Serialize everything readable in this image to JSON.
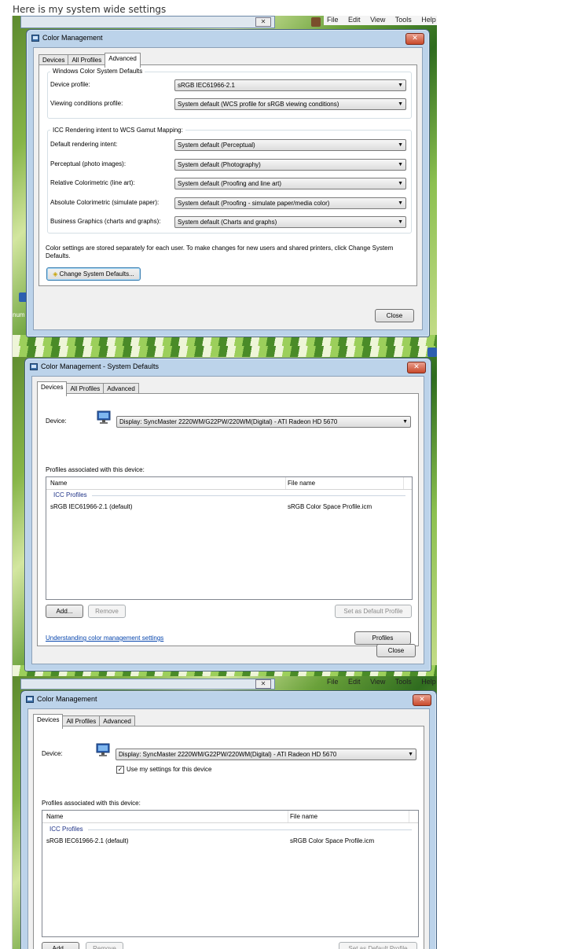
{
  "post": {
    "caption": "Here is my system wide settings"
  },
  "background": {
    "menu": [
      "File",
      "Edit",
      "View",
      "Tools",
      "Help"
    ],
    "menu_b": [
      "File",
      "Edit",
      "View",
      "Tools",
      "Help"
    ],
    "side_label": "num"
  },
  "shot1": {
    "title": "Color Management",
    "tabs": [
      "Devices",
      "All Profiles",
      "Advanced"
    ],
    "wcs_group": "Windows Color System Defaults",
    "device_profile_label": "Device profile:",
    "device_profile_value": "sRGB IEC61966-2.1",
    "viewing_label": "Viewing conditions profile:",
    "viewing_value": "System default (WCS profile for sRGB viewing conditions)",
    "icc_group": "ICC Rendering intent to WCS Gamut Mapping:",
    "rows": [
      {
        "label": "Default rendering intent:",
        "value": "System default (Perceptual)"
      },
      {
        "label": "Perceptual (photo images):",
        "value": "System default (Photography)"
      },
      {
        "label": "Relative Colorimetric (line art):",
        "value": "System default (Proofing and line art)"
      },
      {
        "label": "Absolute Colorimetric (simulate paper):",
        "value": "System default (Proofing - simulate paper/media color)"
      },
      {
        "label": "Business Graphics (charts and graphs):",
        "value": "System default (Charts and graphs)"
      }
    ],
    "note_line1": "Color settings are stored separately for each user. To make changes for new users and shared printers, click Change System",
    "note_line2": "Defaults.",
    "change_button": "Change System Defaults...",
    "close_button": "Close"
  },
  "shot2": {
    "title": "Color Management - System Defaults",
    "tabs": [
      "Devices",
      "All Profiles",
      "Advanced"
    ],
    "device_label": "Device:",
    "device_value": "Display: SyncMaster 2220WM/G22PW/220WM(Digital) - ATI Radeon HD 5670",
    "profiles_label": "Profiles associated with this device:",
    "col_name": "Name",
    "col_file": "File name",
    "group": "ICC Profiles",
    "profile_name": "sRGB IEC61966-2.1 (default)",
    "profile_file": "sRGB Color Space Profile.icm",
    "add_button": "Add...",
    "remove_button": "Remove",
    "default_button": "Set as Default Profile",
    "profiles_button": "Profiles",
    "help_link": "Understanding color management settings",
    "close_button": "Close"
  },
  "shot3": {
    "title": "Color Management",
    "tabs": [
      "Devices",
      "All Profiles",
      "Advanced"
    ],
    "device_label": "Device:",
    "device_value": "Display: SyncMaster 2220WM/G22PW/220WM(Digital) - ATI Radeon HD 5670",
    "use_settings": "Use my settings for this device",
    "use_settings_checked": true,
    "profiles_label": "Profiles associated with this device:",
    "col_name": "Name",
    "col_file": "File name",
    "group": "ICC Profiles",
    "profile_name": "sRGB IEC61966-2.1 (default)",
    "profile_file": "sRGB Color Space Profile.icm",
    "add_button": "Add...",
    "remove_button": "Remove",
    "default_button": "Set as Default Profile"
  },
  "colors": {
    "title_blue": "#bcd3ea",
    "link": "#0645ad",
    "close_red": "#c94a2c"
  }
}
